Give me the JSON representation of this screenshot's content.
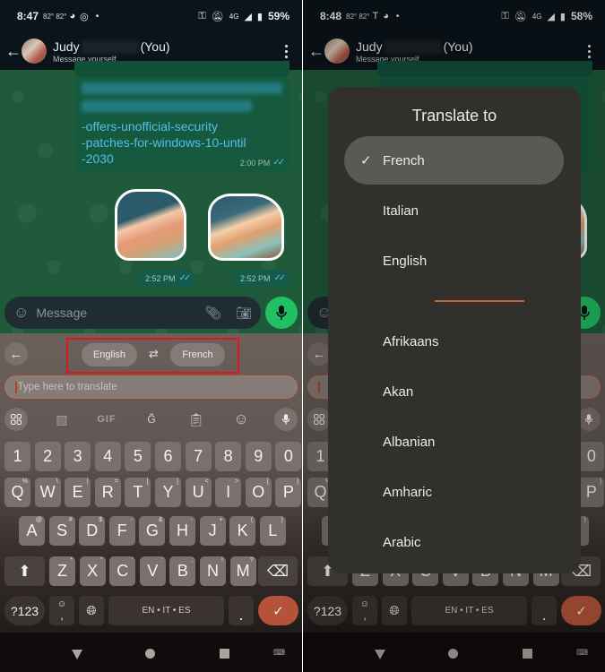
{
  "left": {
    "status": {
      "time": "8:47",
      "temps": "82° 82°",
      "battery": "59%",
      "network": "4G"
    },
    "header": {
      "name": "Judy",
      "you": "(You)",
      "subtitle": "Message yourself"
    },
    "messages": {
      "link_lines": [
        "-offers-unofficial-security",
        "-patches-for-windows-10-until",
        "-2030"
      ],
      "link_time": "2:00 PM",
      "sticker1_time": "2:52 PM",
      "sticker2_time": "2:52 PM"
    },
    "composer": {
      "placeholder": "Message"
    },
    "translate_bar": {
      "source_lang": "English",
      "target_lang": "French",
      "input_placeholder": "Type here to translate"
    },
    "toolbar": {
      "gif_label": "GIF"
    },
    "keyboard": {
      "row_numbers": [
        "1",
        "2",
        "3",
        "4",
        "5",
        "6",
        "7",
        "8",
        "9",
        "0"
      ],
      "row_q": [
        [
          "Q",
          "%"
        ],
        [
          "W",
          "\\"
        ],
        [
          "E",
          "|"
        ],
        [
          "R",
          "="
        ],
        [
          "T",
          "["
        ],
        [
          "Y",
          "]"
        ],
        [
          "U",
          "<"
        ],
        [
          "I",
          ">"
        ],
        [
          "O",
          "{"
        ],
        [
          "P",
          "}"
        ]
      ],
      "row_a": [
        [
          "A",
          "@"
        ],
        [
          "S",
          "#"
        ],
        [
          "D",
          "$"
        ],
        [
          "F",
          "-"
        ],
        [
          "G",
          "&"
        ],
        [
          "H",
          "-"
        ],
        [
          "J",
          "+"
        ],
        [
          "K",
          "("
        ],
        [
          "L",
          ")"
        ]
      ],
      "row_z": [
        [
          "Z",
          "*"
        ],
        [
          "X",
          "\""
        ],
        [
          "C",
          "'"
        ],
        [
          "V",
          ":"
        ],
        [
          "B",
          ";"
        ],
        [
          "N",
          "!"
        ],
        [
          "M",
          "?"
        ]
      ],
      "sym_label": "?123",
      "comma_label": ",",
      "space_label": "EN • IT • ES",
      "period_label": "."
    }
  },
  "right": {
    "status": {
      "time": "8:48",
      "temps": "82° 82°",
      "battery": "58%",
      "network": "4G"
    },
    "header": {
      "name": "Judy",
      "you": "(You)",
      "subtitle": "Message yourself"
    },
    "dialog": {
      "title": "Translate to",
      "recent": [
        {
          "label": "French",
          "selected": true
        },
        {
          "label": "Italian",
          "selected": false
        },
        {
          "label": "English",
          "selected": false
        }
      ],
      "all": [
        "Afrikaans",
        "Akan",
        "Albanian",
        "Amharic",
        "Arabic"
      ]
    },
    "keyboard": {
      "sym_label": "?123",
      "space_label": "EN • IT • ES",
      "period_label": "."
    }
  },
  "colors": {
    "whatsapp_green": "#21c063",
    "chat_bg": "#1f5b3b",
    "link": "#53bdeb",
    "highlight_frame": "#e0141a",
    "enter_key": "#b5533a",
    "dialog_bg": "#31302d",
    "separator": "#c2623a"
  }
}
